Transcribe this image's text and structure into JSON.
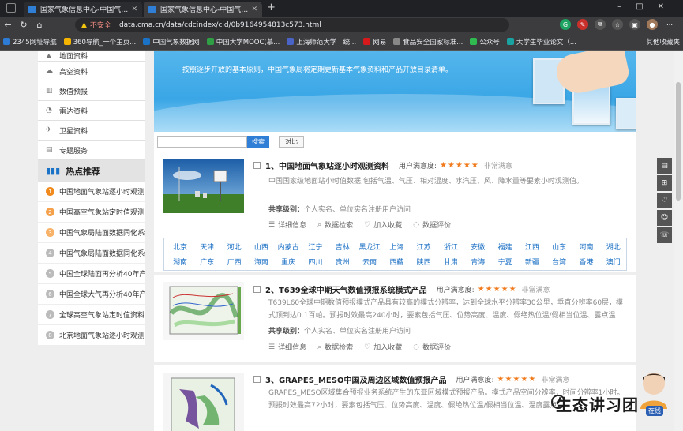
{
  "browser": {
    "tabs": [
      {
        "title": "国家气象信息中心-中国气象数据网"
      },
      {
        "title": "国家气象信息中心-中国气象数据网"
      }
    ],
    "address": {
      "warning": "不安全",
      "url": "data.cma.cn/data/cdcindex/cid/0b9164954813c573.html"
    },
    "bookmarks": [
      {
        "label": "2345网址导航",
        "color": "#2e7bd6"
      },
      {
        "label": "360导航_一个主页...",
        "color": "#f5b400"
      },
      {
        "label": "中国气象数据网",
        "color": "#1a73c7"
      },
      {
        "label": "中国大学MOOC(慕...",
        "color": "#2f9e44"
      },
      {
        "label": "上海师范大学 | 统...",
        "color": "#4a63c6"
      },
      {
        "label": "网易",
        "color": "#d7191c"
      },
      {
        "label": "食品安全国家标准...",
        "color": "#888888"
      },
      {
        "label": "公众号",
        "color": "#2fbb4f"
      },
      {
        "label": "大学生毕业论文（...",
        "color": "#1aa1a1"
      }
    ],
    "bookmarks_more": "其他收藏夹"
  },
  "sidebar": {
    "items": [
      {
        "label": "地面资料",
        "icon": "ground-icon"
      },
      {
        "label": "高空资料",
        "icon": "cloud-icon"
      },
      {
        "label": "数值预报",
        "icon": "chart-icon"
      },
      {
        "label": "雷达资料",
        "icon": "radar-icon"
      },
      {
        "label": "卫星资料",
        "icon": "satellite-icon"
      },
      {
        "label": "专题服务",
        "icon": "document-icon"
      }
    ],
    "hot_title": "热点推荐",
    "hot_items": [
      {
        "num": "1",
        "label": "中国地面气象站逐小时观测"
      },
      {
        "num": "2",
        "label": "中国高空气象站定时值观测"
      },
      {
        "num": "3",
        "label": "中国气象局陆面数据同化系统"
      },
      {
        "num": "4",
        "label": "中国气象局陆面数据同化系统"
      },
      {
        "num": "5",
        "label": "中国全球陆面再分析40年产品"
      },
      {
        "num": "6",
        "label": "中国全球大气再分析40年产品"
      },
      {
        "num": "7",
        "label": "全球高空气象站定时值资料"
      },
      {
        "num": "8",
        "label": "北京地面气象站逐小时观测"
      }
    ]
  },
  "banner": {
    "text": "按照逐步开放的基本原则，中国气象局将定期更新基本气象资料和产品开放目录清单。"
  },
  "search": {
    "button": "搜索",
    "compare": "对比",
    "placeholder": ""
  },
  "cards": [
    {
      "title": "1、中国地面气象站逐小时观测资料",
      "sat_label": "用户满意度:",
      "stars": "★★★★★",
      "sat_value": "非常满意",
      "desc": "中国国家级地面站小时值数据,包括气温、气压、相对湿度、水汽压、风、降水量等要素小时观测值。",
      "share_label": "共享级别：",
      "share_value": "个人实名、单位实名注册用户访问",
      "actions": [
        "详细信息",
        "数据检索",
        "加入收藏",
        "数据评价"
      ]
    },
    {
      "title": "2、T639全球中期天气数值预报系统模式产品",
      "sat_label": "用户满意度:",
      "stars": "★★★★★",
      "sat_value": "非常满意",
      "desc": "T639L60全球中期数值预报模式产品具有较高的模式分辨率，达到全球水平分辨率30公里，垂直分辨率60层，模式顶到达0.1百帕。预报时效最高240小时，要素包括气压、位势高度、温度、假绝热位温/假相当位温、露点温度、温度露点...",
      "share_label": "共享级别：",
      "share_value": "个人实名、单位实名注册用户访问",
      "actions": [
        "详细信息",
        "数据检索",
        "加入收藏",
        "数据评价"
      ]
    },
    {
      "title": "3、GRAPES_MESO中国及周边区域数值预报产品",
      "sat_label": "用户满意度:",
      "stars": "★★★★★",
      "sat_value": "非常满意",
      "desc": "GRAPES_MESO区域集合预报业务系统产生的东亚区域模式预报产品。模式产品空间分辨率，时间分辨率1小时。预报时效最高72小时，要素包括气压、位势高度、温度、假绝热位温/假相当位温、温度露点...",
      "share_label": "",
      "share_value": "",
      "actions": []
    }
  ],
  "regions": [
    "北京",
    "天津",
    "河北",
    "山西",
    "内蒙古",
    "辽宁",
    "吉林",
    "黑龙江",
    "上海",
    "江苏",
    "浙江",
    "安徽",
    "福建",
    "江西",
    "山东",
    "河南",
    "湖北",
    "湖南",
    "广东",
    "广西",
    "海南",
    "重庆",
    "四川",
    "贵州",
    "云南",
    "西藏",
    "陕西",
    "甘肃",
    "青海",
    "宁夏",
    "新疆",
    "台湾",
    "香港",
    "澳门"
  ],
  "watermark": {
    "text": "生态讲习团"
  },
  "chat": {
    "badge": "在线"
  }
}
